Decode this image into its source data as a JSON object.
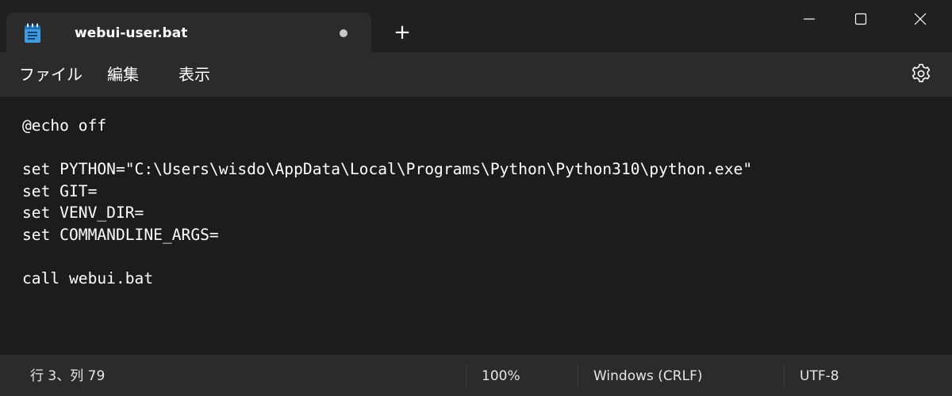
{
  "titlebar": {
    "tab_title": "webui-user.bat",
    "tab_icon": "notepad-icon",
    "unsaved_indicator": "unsaved-dot-icon",
    "new_tab_label": "+"
  },
  "window_controls": {
    "minimize_icon": "minimize-icon",
    "maximize_icon": "maximize-icon",
    "close_icon": "close-icon"
  },
  "menu": {
    "file": "ファイル",
    "edit": "編集",
    "view": "表示",
    "settings_icon": "gear-icon"
  },
  "editor": {
    "lines": [
      "@echo off",
      "",
      "set PYTHON=\"C:\\Users\\wisdo\\AppData\\Local\\Programs\\Python\\Python310\\python.exe\"",
      "set GIT=",
      "set VENV_DIR=",
      "set COMMANDLINE_ARGS=",
      "",
      "call webui.bat"
    ]
  },
  "status": {
    "position": "行 3、列 79",
    "zoom": "100%",
    "line_ending": "Windows (CRLF)",
    "encoding": "UTF-8"
  },
  "colors": {
    "titlebar_bg": "#202020",
    "tab_bg": "#2b2b2b",
    "editor_bg": "#1c1c1c",
    "text": "#ffffff",
    "notepad_icon_blue": "#3f9be0"
  }
}
